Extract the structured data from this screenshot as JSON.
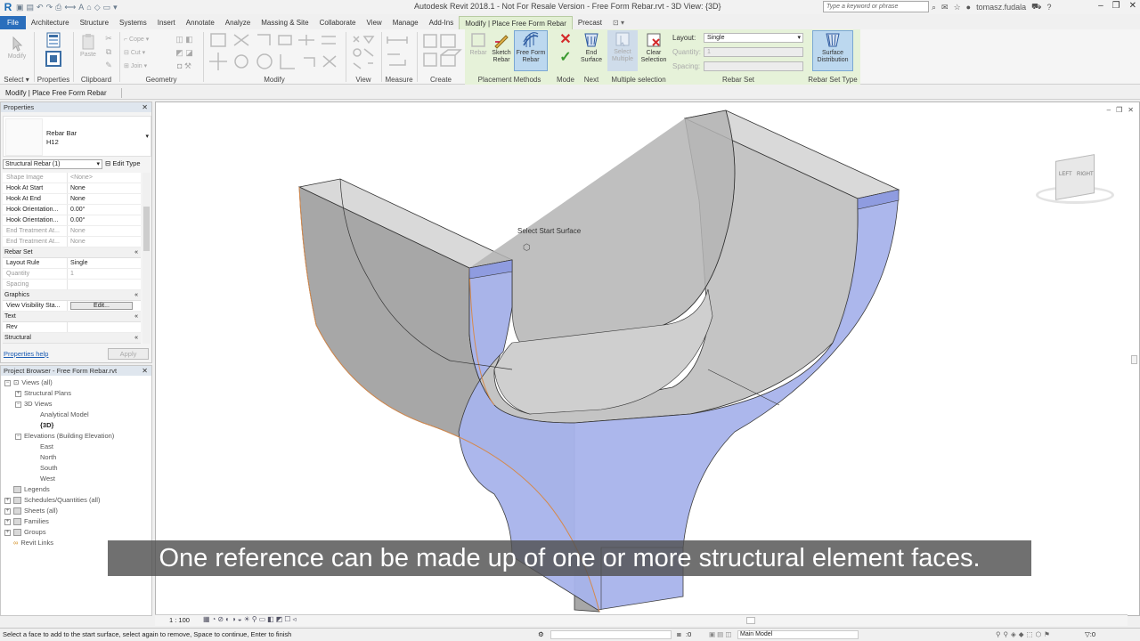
{
  "app": {
    "title": "Autodesk Revit 2018.1 - Not For Resale Version -   Free Form Rebar.rvt - 3D View: {3D}",
    "search_placeholder": "Type a keyword or phrase",
    "user": "tomasz.fudala"
  },
  "tabs": [
    {
      "label": "File"
    },
    {
      "label": "Architecture"
    },
    {
      "label": "Structure"
    },
    {
      "label": "Systems"
    },
    {
      "label": "Insert"
    },
    {
      "label": "Annotate"
    },
    {
      "label": "Analyze"
    },
    {
      "label": "Massing & Site"
    },
    {
      "label": "Collaborate"
    },
    {
      "label": "View"
    },
    {
      "label": "Manage"
    },
    {
      "label": "Add-Ins"
    },
    {
      "label": "Modify | Place Free Form Rebar"
    },
    {
      "label": "Precast"
    }
  ],
  "ribbon": {
    "select": {
      "modify": "Modify",
      "panel": "Select"
    },
    "properties": {
      "btn": "Properties",
      "panel": "Properties"
    },
    "clipboard": {
      "paste": "Paste",
      "panel": "Clipboard"
    },
    "geometry": {
      "cope": "Cope",
      "cut": "Cut",
      "join": "Join",
      "panel": "Geometry"
    },
    "modify_panel": "Modify",
    "view_panel": "View",
    "measure_panel": "Measure",
    "create_panel": "Create",
    "placement": {
      "rebar": "Rebar",
      "sketch1": "Sketch",
      "sketch2": "Rebar",
      "free1": "Free Form",
      "free2": "Rebar",
      "panel": "Placement Methods"
    },
    "mode": {
      "panel": "Mode"
    },
    "next": {
      "end1": "End",
      "end2": "Surface",
      "panel": "Next"
    },
    "multi": {
      "sel1": "Select",
      "sel2": "Multiple",
      "clr1": "Clear",
      "clr2": "Selection",
      "panel": "Multiple selection"
    },
    "rebarset": {
      "layout_label": "Layout:",
      "layout_value": "Single",
      "quantity_label": "Quantity:",
      "quantity_value": "1",
      "spacing_label": "Spacing:",
      "panel": "Rebar Set"
    },
    "rebarsettype": {
      "btn1": "Surface",
      "btn2": "Distribution",
      "panel": "Rebar Set Type"
    }
  },
  "options_bar": {
    "label": "Modify | Place Free Form Rebar"
  },
  "properties": {
    "header": "Properties",
    "type_name": "Rebar Bar",
    "type_size": "H12",
    "instance_selector": "Structural Rebar (1)",
    "edit_type": "Edit Type",
    "rows": [
      {
        "k": "Shape Image",
        "v": "<None>",
        "dim": true
      },
      {
        "k": "Hook At Start",
        "v": "None"
      },
      {
        "k": "Hook At End",
        "v": "None"
      },
      {
        "k": "Hook Orientation...",
        "v": "0.00°"
      },
      {
        "k": "Hook Orientation...",
        "v": "0.00°"
      },
      {
        "k": "End Treatment At...",
        "v": "None",
        "dim": true
      },
      {
        "k": "End Treatment At...",
        "v": "None",
        "dim": true
      }
    ],
    "group_rebarset": "Rebar Set",
    "rebarset_rows": [
      {
        "k": "Layout Rule",
        "v": "Single"
      },
      {
        "k": "Quantity",
        "v": "1",
        "dim": true
      },
      {
        "k": "Spacing",
        "v": "",
        "dim": true
      }
    ],
    "group_graphics": "Graphics",
    "graphics_row": {
      "k": "View Visibility Sta...",
      "v": "Edit..."
    },
    "group_text": "Text",
    "text_row": {
      "k": "Rev",
      "v": ""
    },
    "group_structural": "Structural",
    "help": "Properties help",
    "apply": "Apply"
  },
  "browser": {
    "header": "Project Browser - Free Form Rebar.rvt",
    "nodes": [
      {
        "label": "Views (all)"
      },
      {
        "label": "Structural Plans"
      },
      {
        "label": "3D Views"
      },
      {
        "label": "Analytical Model"
      },
      {
        "label": "{3D}"
      },
      {
        "label": "Elevations (Building Elevation)"
      },
      {
        "label": "East"
      },
      {
        "label": "North"
      },
      {
        "label": "South"
      },
      {
        "label": "West"
      },
      {
        "label": "Legends"
      },
      {
        "label": "Schedules/Quantities (all)"
      },
      {
        "label": "Sheets (all)"
      },
      {
        "label": "Families"
      },
      {
        "label": "Groups"
      },
      {
        "label": "Revit Links"
      }
    ]
  },
  "viewport": {
    "tooltip": "Select Start Surface",
    "viewcube_left": "LEFT",
    "viewcube_right": "RIGHT",
    "scale": "1 : 100"
  },
  "status": {
    "message": "Select a face to add to the start surface, select again to remove, Space to continue, Enter to finish",
    "coord": ":0",
    "model": "Main Model"
  },
  "subtitle": "One reference can be made up of one or more structural element faces.",
  "colors": {
    "accent": "#2a6ebc",
    "context_tab": "#e3f0d4",
    "selected_face": "#a8b4ec"
  }
}
